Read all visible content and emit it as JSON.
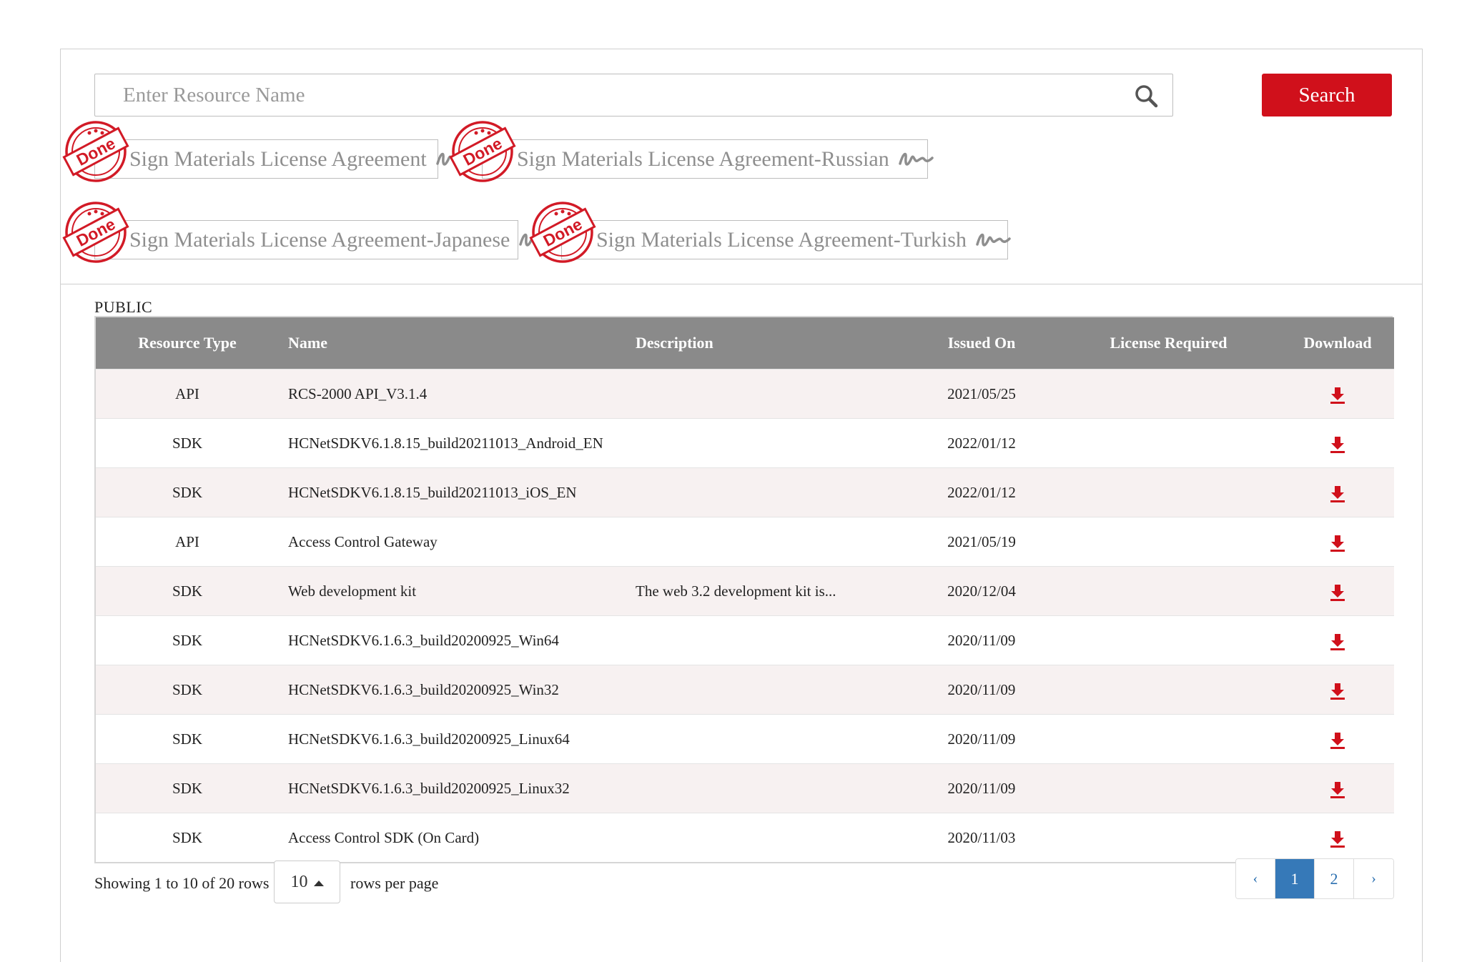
{
  "search": {
    "placeholder": "Enter Resource Name",
    "button_label": "Search"
  },
  "agreements": [
    {
      "label": "Sign Materials License Agreement",
      "stamp": "Done"
    },
    {
      "label": "Sign Materials License Agreement-Russian",
      "stamp": "Done"
    },
    {
      "label": "Sign Materials License Agreement-Japanese",
      "stamp": "Done"
    },
    {
      "label": "Sign Materials License Agreement-Turkish",
      "stamp": "Done"
    }
  ],
  "section_label": "PUBLIC",
  "table": {
    "headers": {
      "type": "Resource Type",
      "name": "Name",
      "description": "Description",
      "issued": "Issued On",
      "license": "License Required",
      "download": "Download"
    },
    "rows": [
      {
        "type": "API",
        "name": "RCS-2000 API_V3.1.4",
        "description": "",
        "issued": "2021/05/25",
        "license": ""
      },
      {
        "type": "SDK",
        "name": "HCNetSDKV6.1.8.15_build20211013_Android_EN",
        "description": "",
        "issued": "2022/01/12",
        "license": ""
      },
      {
        "type": "SDK",
        "name": "HCNetSDKV6.1.8.15_build20211013_iOS_EN",
        "description": "",
        "issued": "2022/01/12",
        "license": ""
      },
      {
        "type": "API",
        "name": "Access Control Gateway",
        "description": "",
        "issued": "2021/05/19",
        "license": ""
      },
      {
        "type": "SDK",
        "name": "Web development kit",
        "description": "The web 3.2 development kit is...",
        "issued": "2020/12/04",
        "license": ""
      },
      {
        "type": "SDK",
        "name": "HCNetSDKV6.1.6.3_build20200925_Win64",
        "description": "",
        "issued": "2020/11/09",
        "license": ""
      },
      {
        "type": "SDK",
        "name": "HCNetSDKV6.1.6.3_build20200925_Win32",
        "description": "",
        "issued": "2020/11/09",
        "license": ""
      },
      {
        "type": "SDK",
        "name": "HCNetSDKV6.1.6.3_build20200925_Linux64",
        "description": "",
        "issued": "2020/11/09",
        "license": ""
      },
      {
        "type": "SDK",
        "name": "HCNetSDKV6.1.6.3_build20200925_Linux32",
        "description": "",
        "issued": "2020/11/09",
        "license": ""
      },
      {
        "type": "SDK",
        "name": "Access Control SDK (On Card)",
        "description": "",
        "issued": "2020/11/03",
        "license": ""
      }
    ]
  },
  "pager": {
    "showing": "Showing 1 to 10 of 20 rows",
    "rows_per_page_value": "10",
    "rows_per_page_label": "rows per page",
    "prev": "‹",
    "next": "›",
    "pages": [
      "1",
      "2"
    ],
    "current_page": "1"
  },
  "colors": {
    "accent": "#d0101b",
    "table_header": "#8a8a8a",
    "page_active": "#3679b8"
  },
  "icons": {
    "search": "search-icon",
    "signature": "signature-icon",
    "stamp": "done-stamp-icon",
    "download": "download-icon"
  }
}
